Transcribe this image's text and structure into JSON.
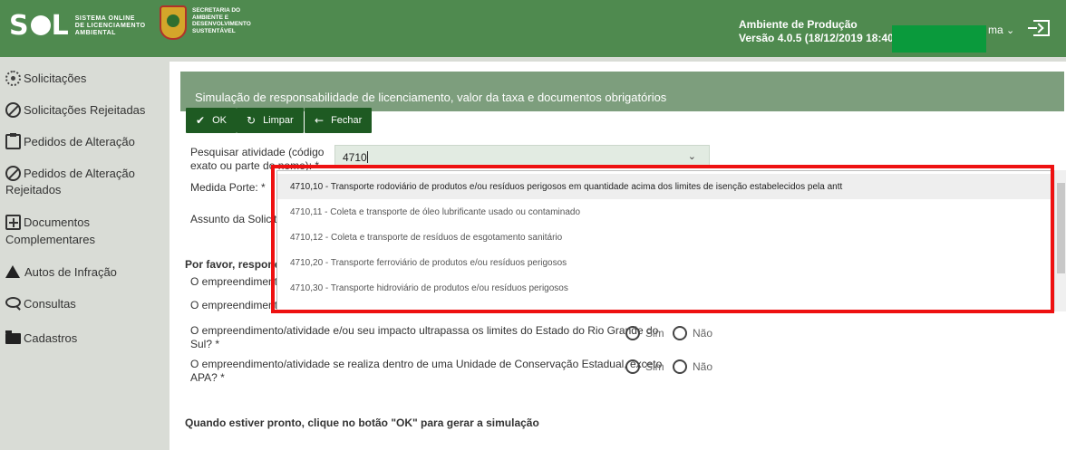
{
  "header": {
    "logo_main": "S",
    "logo_tail": "L",
    "logo_subtitle_line1": "SISTEMA ONLINE",
    "logo_subtitle_line2": "DE LICENCIAMENTO",
    "logo_subtitle_line3": "AMBIENTAL",
    "secretaria_line1": "SECRETARIA DO",
    "secretaria_line2": "AMBIENTE E",
    "secretaria_line3": "DESENVOLVIMENTO",
    "secretaria_line4": "SUSTENTÁVEL",
    "env_prefix": "Ambiente de ",
    "env_name": "Produção",
    "version": "Versão 4.0.5 (18/12/2019 18:40)",
    "user_suffix": "ma",
    "colors": {
      "bar": "#4f8a4f",
      "redacted_block": "#0a9a3c"
    }
  },
  "sidebar": {
    "items": [
      {
        "label": "Solicitações",
        "icon": "sun-icon"
      },
      {
        "label": "Solicitações Rejeitadas",
        "icon": "ban-icon"
      },
      {
        "label": "Pedidos de Alteração",
        "icon": "clipboard-icon"
      },
      {
        "label_line1": "Pedidos de Alteração",
        "label_line2": "Rejeitados",
        "icon": "ban-icon"
      },
      {
        "label_line1": "Documentos",
        "label_line2": "Complementares",
        "icon": "plus-box-icon"
      },
      {
        "label": "Autos de Infração",
        "icon": "warning-icon"
      },
      {
        "label": "Consultas",
        "icon": "search-icon"
      },
      {
        "label": "Cadastros",
        "icon": "folder-icon"
      }
    ]
  },
  "main": {
    "title": "Simulação de responsabilidade de licenciamento, valor da taxa e documentos obrigatórios",
    "toolbar": {
      "ok_label": "OK",
      "clear_label": "Limpar",
      "close_label": "Fechar"
    },
    "search_label_line1": "Pesquisar atividade (código",
    "search_label_line2": "exato ou parte do nome): *",
    "search_value": "4710",
    "porte_label": "Medida Porte:  *",
    "assunto_label": "Assunto da Solicita",
    "section_title": "Por favor, responda",
    "q1_partial": "O empreendimento",
    "q2_partial": "O empreendimento",
    "q3_line1": "O empreendimento/atividade e/ou seu impacto ultrapassa os limites do Estado do Rio Grande do",
    "q3_line2": "Sul? *",
    "q4_line1": "O empreendimento/atividade se realiza dentro de uma Unidade de Conservação Estadual, exceto",
    "q4_line2": "APA? *",
    "yes_label": "Sim",
    "no_label": "Não",
    "footer_text": "Quando estiver pronto, clique no botão \"OK\" para gerar a simulação"
  },
  "dropdown": {
    "options": [
      "4710,10 - Transporte rodoviário de produtos e/ou resíduos perigosos em quantidade acima dos limites de isenção estabelecidos pela antt",
      "4710,11 - Coleta e transporte de óleo lubrificante usado ou contaminado",
      "4710,12 - Coleta e transporte de resíduos de esgotamento sanitário",
      "4710,20 - Transporte ferroviário de produtos e/ou resíduos perigosos",
      "4710,30 - Transporte hidroviário de produtos e/ou resíduos perigosos"
    ],
    "highlight_color": "#ee1111"
  }
}
